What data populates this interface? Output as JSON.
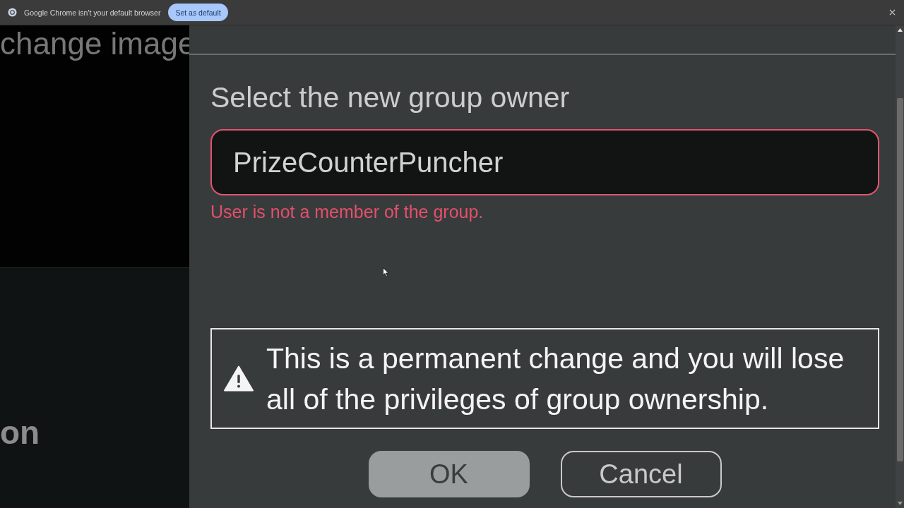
{
  "notification_bar": {
    "message": "Google Chrome isn't your default browser",
    "button": "Set as default"
  },
  "background_page": {
    "heading": "change image",
    "label": "on"
  },
  "dialog": {
    "title": "Select the new group owner",
    "owner_field": {
      "value": "PrizeCounterPuncher",
      "invalid": true
    },
    "error": "User is not a member of the group.",
    "warning": "This is a permanent change and you will lose all of the privileges of group ownership.",
    "buttons": [
      {
        "label": "OK",
        "kind": "primary"
      },
      {
        "label": "Cancel",
        "kind": "secondary"
      }
    ]
  }
}
